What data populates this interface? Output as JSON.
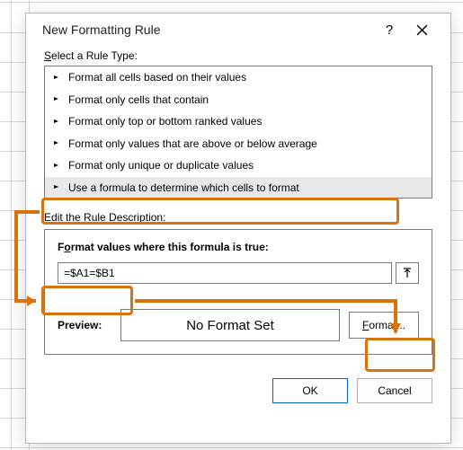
{
  "dialog": {
    "title": "New Formatting Rule",
    "help_tooltip": "Help",
    "close_tooltip": "Close"
  },
  "rule_type": {
    "label_prefix": "S",
    "label_rest": "elect a Rule Type:",
    "items": [
      "Format all cells based on their values",
      "Format only cells that contain",
      "Format only top or bottom ranked values",
      "Format only values that are above or below average",
      "Format only unique or duplicate values",
      "Use a formula to determine which cells to format"
    ],
    "selected_index": 5
  },
  "description": {
    "label_prefix": "E",
    "label_rest": "dit the Rule Description:",
    "formula_label_prefix": "F",
    "formula_label_mid": "o",
    "formula_label_rest": "rmat values where this formula is true:",
    "formula_value": "=$A1=$B1",
    "preview_label": "Preview:",
    "preview_text": "No Format Set",
    "format_button_prefix": "F",
    "format_button_rest": "ormat..."
  },
  "footer": {
    "ok": "OK",
    "cancel": "Cancel"
  },
  "annotation_color": "#d9730d"
}
